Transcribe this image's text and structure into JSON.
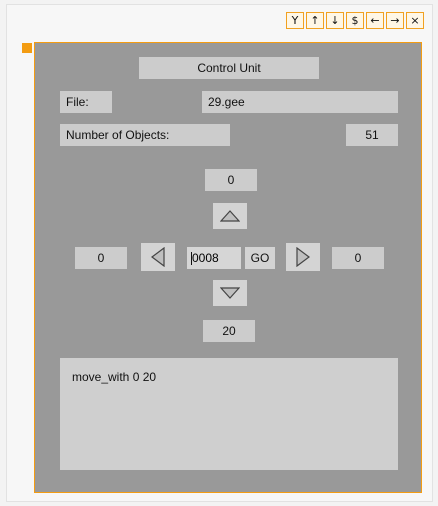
{
  "toolbar": {
    "buttons": [
      {
        "icon": "merge-icon",
        "glyph": "Y"
      },
      {
        "icon": "arrow-up-icon",
        "glyph": "↑"
      },
      {
        "icon": "arrow-down-icon",
        "glyph": "↓"
      },
      {
        "icon": "dollar-icon",
        "glyph": "$"
      },
      {
        "icon": "arrow-left-icon",
        "glyph": "←"
      },
      {
        "icon": "arrow-right-icon",
        "glyph": "→"
      },
      {
        "icon": "close-icon",
        "glyph": "×"
      }
    ]
  },
  "panel": {
    "title": "Control Unit",
    "file_label": "File:",
    "file_value": "29.gee",
    "objects_label": "Number of Objects:",
    "objects_value": "51",
    "top_value": "0",
    "left_value": "0",
    "step_value": "0008",
    "go_label": "GO",
    "right_value": "0",
    "bottom_value": "20",
    "console_text": "move_with 0 20"
  },
  "colors": {
    "panel_bg": "#999999",
    "field_bg": "#cccccc",
    "accent": "#f39c12"
  }
}
